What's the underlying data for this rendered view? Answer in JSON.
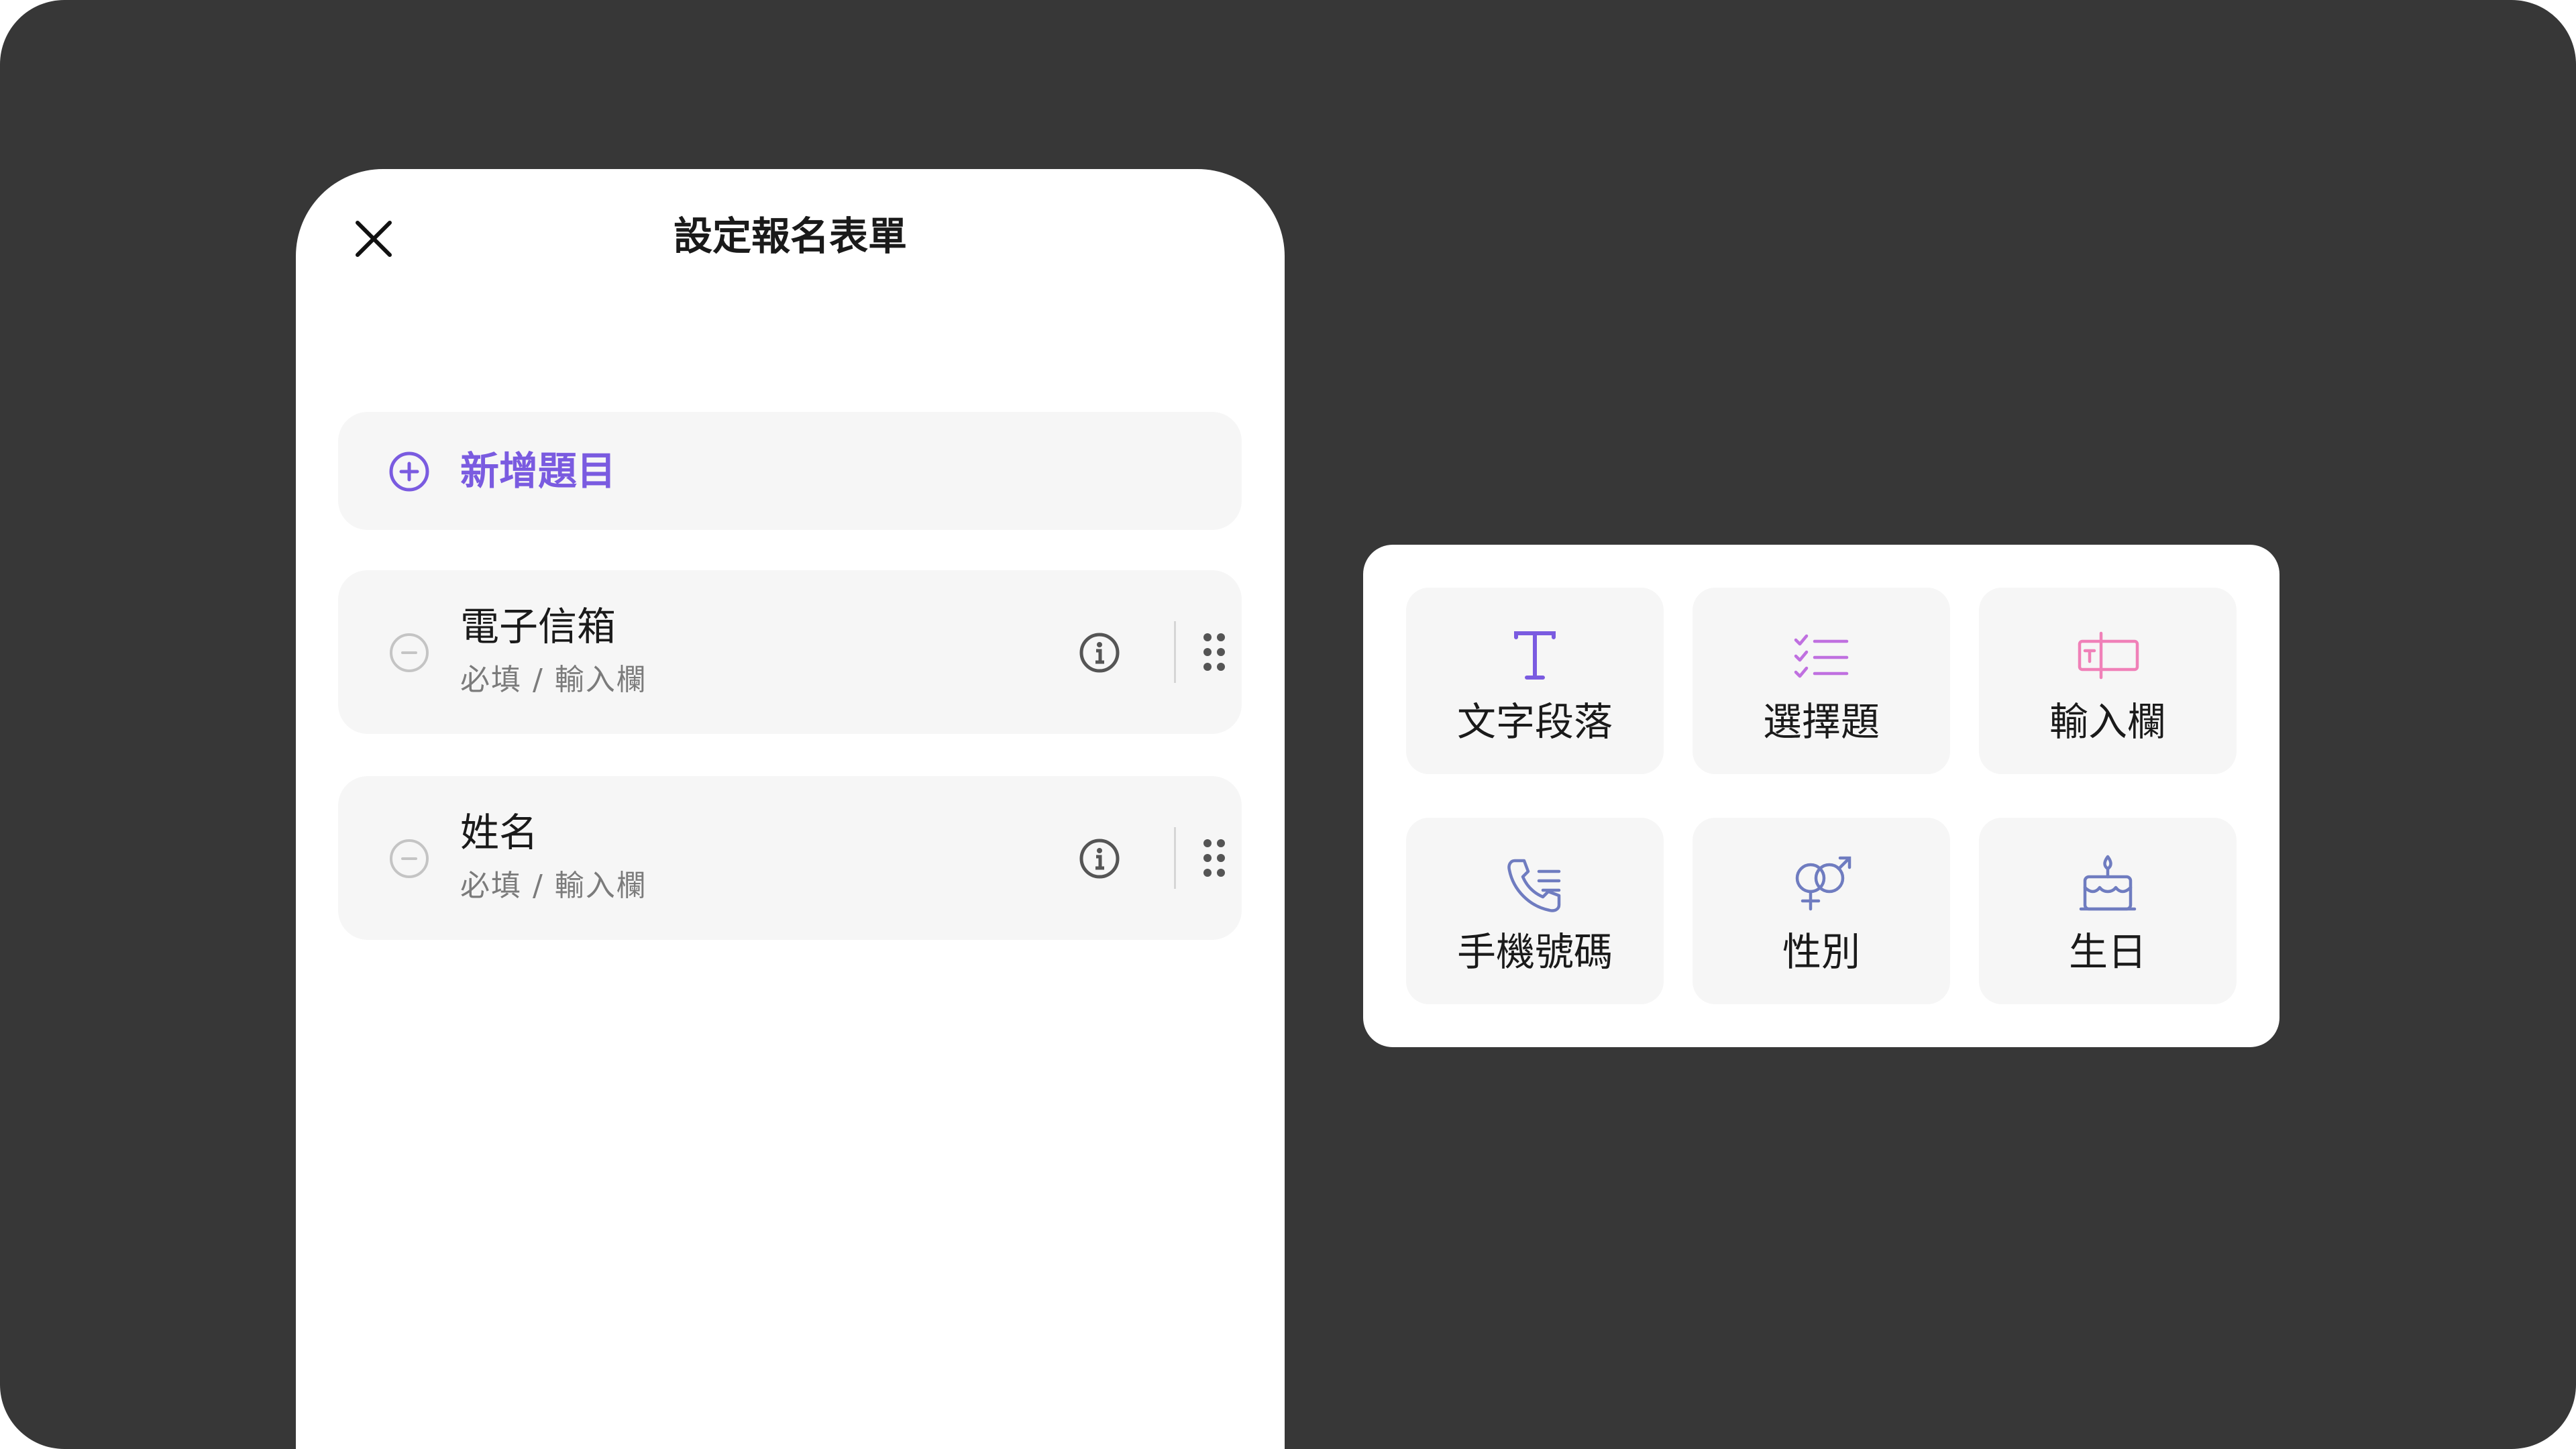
{
  "sheet": {
    "title": "設定報名表單",
    "add_label": "新增題目",
    "questions": [
      {
        "title": "電子信箱",
        "subtitle": "必填 / 輸入欄"
      },
      {
        "title": "姓名",
        "subtitle": "必填 / 輸入欄"
      }
    ]
  },
  "picker": {
    "options": [
      {
        "label": "文字段落",
        "icon": "text-paragraph-icon",
        "color": "#7a5be0"
      },
      {
        "label": "選擇題",
        "icon": "checklist-icon",
        "color": "#c070e0"
      },
      {
        "label": "輸入欄",
        "icon": "input-field-icon",
        "color": "#f080b8"
      },
      {
        "label": "手機號碼",
        "icon": "phone-icon",
        "color": "#6f7cc0"
      },
      {
        "label": "性別",
        "icon": "gender-icon",
        "color": "#6f7cc0"
      },
      {
        "label": "生日",
        "icon": "birthday-cake-icon",
        "color": "#6f7cc0"
      }
    ]
  },
  "colors": {
    "background": "#373737",
    "accent": "#7a5be0",
    "row_bg": "#f6f6f6"
  }
}
